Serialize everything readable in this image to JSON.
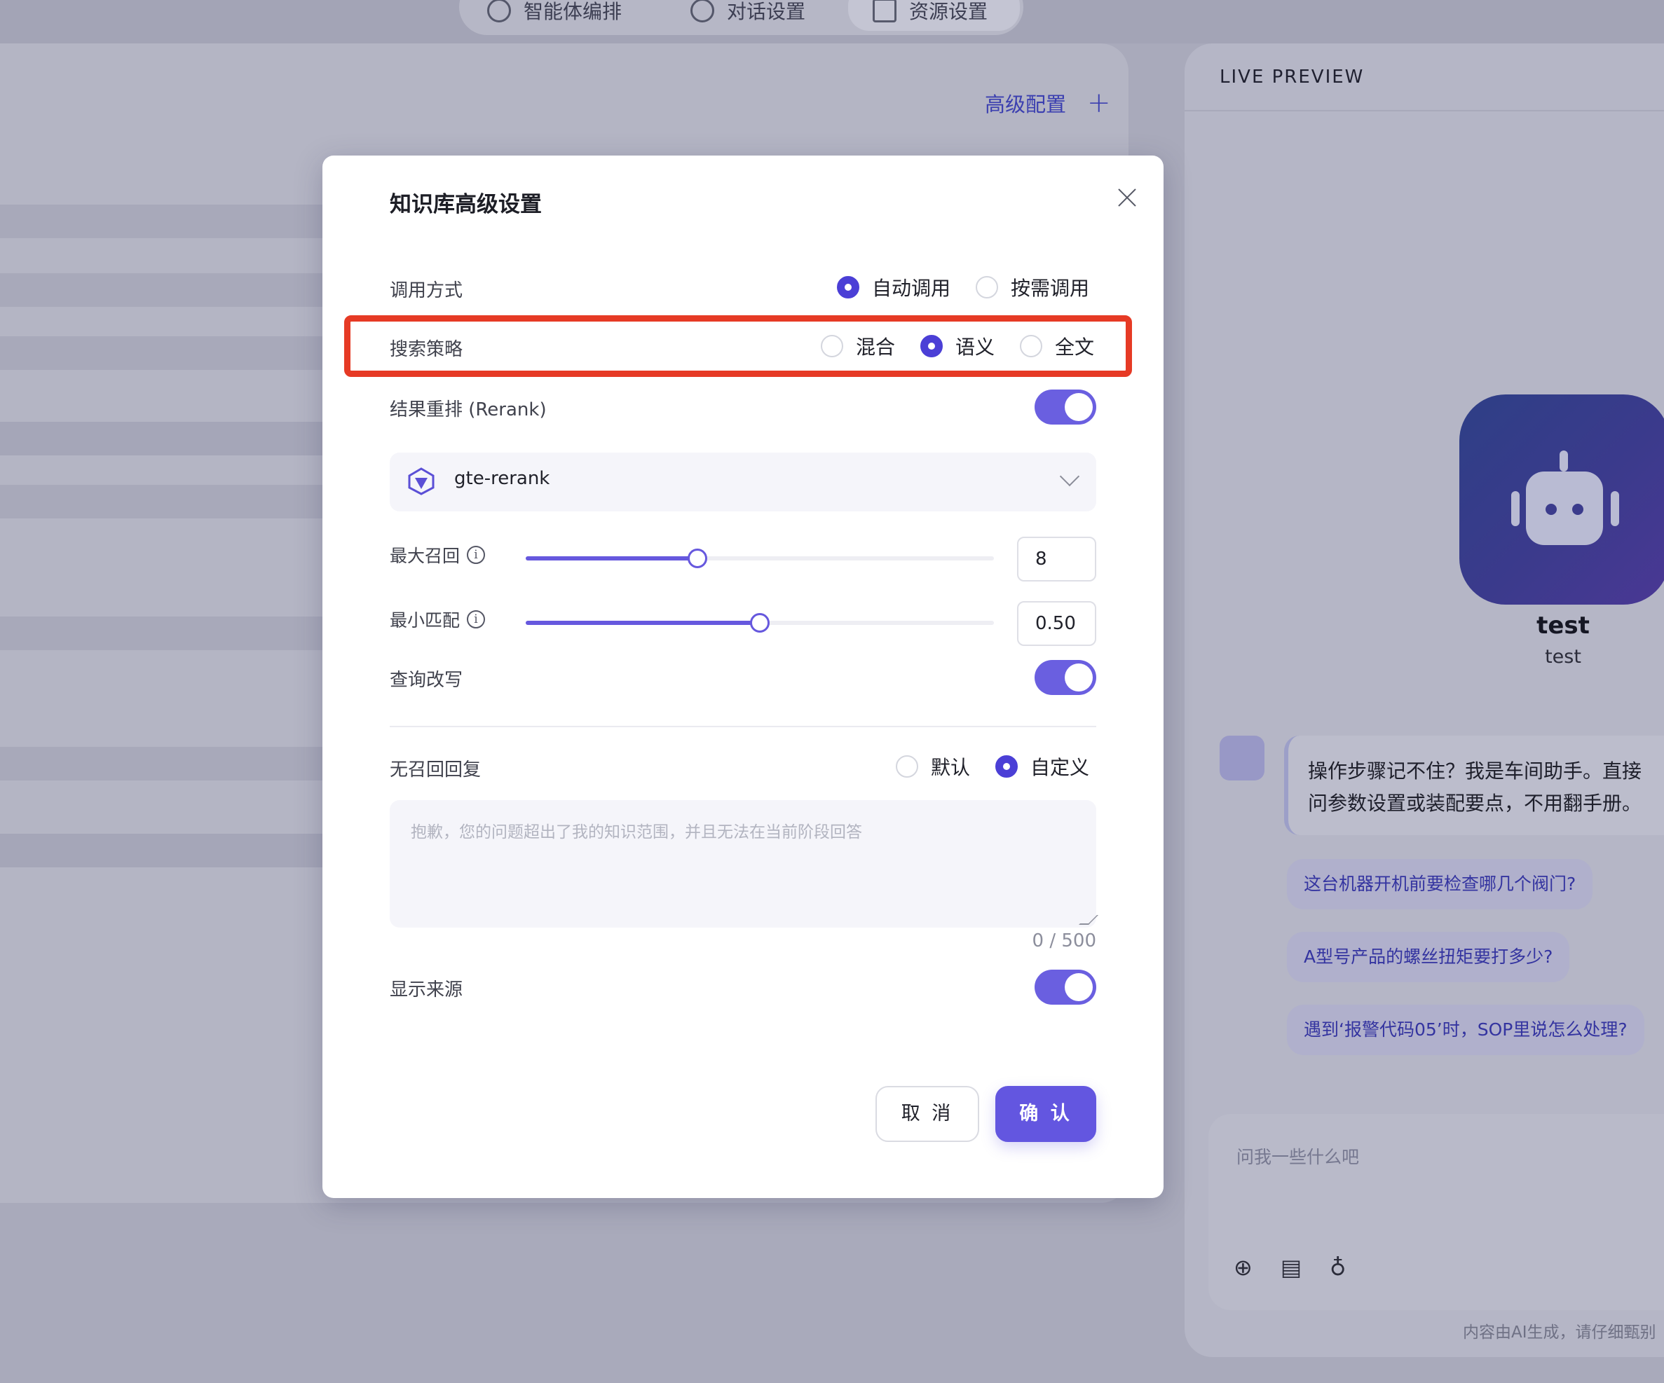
{
  "background": {
    "nav": {
      "tab1_label": "智能体编排",
      "tab2_label": "对话设置",
      "tab3_label": "资源设置"
    },
    "advanced_config_label": "高级配置",
    "advanced_config_plus": "+",
    "preview": {
      "title": "LIVE PREVIEW",
      "bot_name": "test",
      "bot_desc": "test",
      "greeting": "操作步骤记不住？我是车间助手。直接问参数设置或装配要点，不用翻手册。",
      "suggestions": [
        "这台机器开机前要检查哪几个阀门?",
        "A型号产品的螺丝扭矩要打多少?",
        "遇到‘报警代码05’时，SOP里说怎么处理?"
      ],
      "input_placeholder": "问我一些什么吧",
      "disclaimer": "内容由AI生成，请仔细甄别"
    }
  },
  "modal": {
    "title": "知识库高级设置",
    "invoke": {
      "label": "调用方式",
      "options": [
        "自动调用",
        "按需调用"
      ],
      "selected": "自动调用"
    },
    "search": {
      "label": "搜索策略",
      "options": [
        "混合",
        "语义",
        "全文"
      ],
      "selected": "语义"
    },
    "rerank": {
      "label": "结果重排 (Rerank)",
      "enabled": true,
      "model": "gte-rerank"
    },
    "max_recall": {
      "label": "最大召回",
      "value": "8",
      "fraction": 0.367
    },
    "min_match": {
      "label": "最小匹配",
      "value": "0.50",
      "fraction": 0.5
    },
    "query_rewrite": {
      "label": "查询改写",
      "enabled": true
    },
    "no_recall_reply": {
      "label": "无召回回复",
      "options": [
        "默认",
        "自定义"
      ],
      "selected": "自定义",
      "placeholder": "抱歉，您的问题超出了我的知识范围，并且无法在当前阶段回答",
      "counter": "0 / 500"
    },
    "show_source": {
      "label": "显示来源",
      "enabled": true
    },
    "cancel_label": "取 消",
    "confirm_label": "确 认"
  },
  "colors": {
    "accent": "#6356e0",
    "highlight": "#e63a25"
  }
}
